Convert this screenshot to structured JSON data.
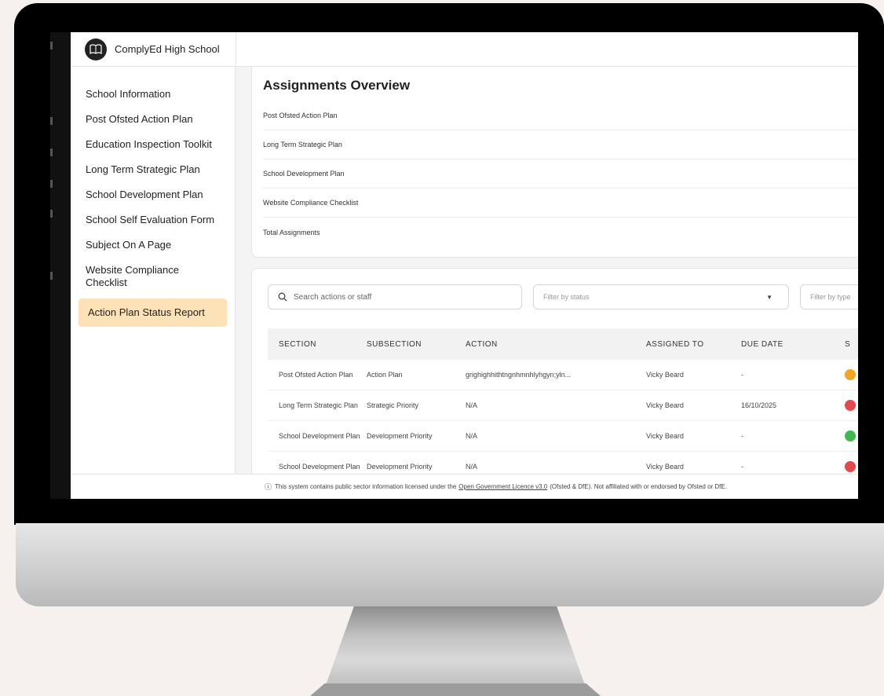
{
  "app": {
    "school_name": "ComplyEd High School"
  },
  "sidebar": {
    "items": [
      {
        "label": "School Information"
      },
      {
        "label": "Post Ofsted Action Plan"
      },
      {
        "label": "Education Inspection Toolkit"
      },
      {
        "label": "Long Term Strategic Plan"
      },
      {
        "label": "School Development Plan"
      },
      {
        "label": "School Self Evaluation Form"
      },
      {
        "label": "Subject On A Page"
      },
      {
        "label": "Website Compliance Checklist"
      },
      {
        "label": "Action Plan Status Report",
        "active": true
      }
    ]
  },
  "overview": {
    "title": "Assignments Overview",
    "rows": [
      "Post Ofsted Action Plan",
      "Long Term Strategic Plan",
      "School Development Plan",
      "Website Compliance Checklist",
      "Total Assignments"
    ]
  },
  "filters": {
    "search_placeholder": "Search actions or staff",
    "status_placeholder": "Filter by status",
    "type_placeholder": "Filter by type"
  },
  "table": {
    "headers": [
      "SECTION",
      "SUBSECTION",
      "ACTION",
      "ASSIGNED TO",
      "DUE DATE",
      "S"
    ],
    "rows": [
      {
        "section": "Post Ofsted Action Plan",
        "subsection": "Action Plan",
        "action": "grighighhithtngnhmnhlyhgyn;yln...",
        "assigned_to": "Vicky Beard",
        "due_date": "-",
        "status_color": "#f5a524"
      },
      {
        "section": "Long Term Strategic Plan",
        "subsection": "Strategic Priority",
        "action": "N/A",
        "assigned_to": "Vicky Beard",
        "due_date": "16/10/2025",
        "status_color": "#e5484d"
      },
      {
        "section": "School Development Plan",
        "subsection": "Development Priority",
        "action": "N/A",
        "assigned_to": "Vicky Beard",
        "due_date": "-",
        "status_color": "#3fb950"
      },
      {
        "section": "School Development Plan",
        "subsection": "Development Priority",
        "action": "N/A",
        "assigned_to": "Vicky Beard",
        "due_date": "-",
        "status_color": "#e5484d"
      }
    ]
  },
  "footer": {
    "text_before": "This system contains public sector information licensed under the",
    "link": "Open Government Licence v3.0",
    "text_after": "(Ofsted & DfE). Not affiliated with or endorsed by Ofsted or DfE."
  }
}
